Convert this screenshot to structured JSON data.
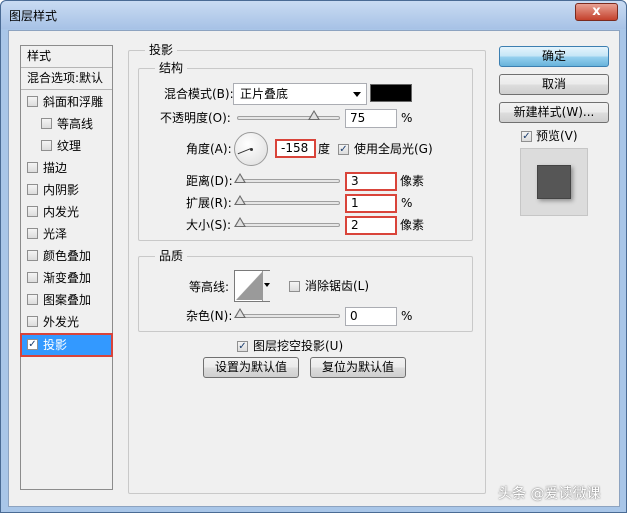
{
  "window": {
    "title": "图层样式",
    "close_glyph": "x"
  },
  "sidebar": {
    "header": "样式",
    "blend_options": "混合选项:默认",
    "items": [
      {
        "label": "斜面和浮雕",
        "checked": false,
        "indent": false
      },
      {
        "label": "等高线",
        "checked": false,
        "indent": true
      },
      {
        "label": "纹理",
        "checked": false,
        "indent": true
      },
      {
        "label": "描边",
        "checked": false,
        "indent": false
      },
      {
        "label": "内阴影",
        "checked": false,
        "indent": false
      },
      {
        "label": "内发光",
        "checked": false,
        "indent": false
      },
      {
        "label": "光泽",
        "checked": false,
        "indent": false
      },
      {
        "label": "颜色叠加",
        "checked": false,
        "indent": false
      },
      {
        "label": "渐变叠加",
        "checked": false,
        "indent": false
      },
      {
        "label": "图案叠加",
        "checked": false,
        "indent": false
      },
      {
        "label": "外发光",
        "checked": false,
        "indent": false
      },
      {
        "label": "投影",
        "checked": true,
        "indent": false,
        "selected": true
      }
    ],
    "check_glyph": "✓"
  },
  "drop_shadow": {
    "title": "投影",
    "structure": {
      "title": "结构",
      "blend_mode_label": "混合模式(B):",
      "blend_mode_value": "正片叠底",
      "blend_color": "#000000",
      "opacity_label": "不透明度(O):",
      "opacity_value": "75",
      "opacity_level": 0.75,
      "percent": "%",
      "angle_label": "角度(A):",
      "angle_value": "-158",
      "angle_unit": "度",
      "global_light_label": "使用全局光(G)",
      "global_light_checked": true,
      "distance_label": "距离(D):",
      "distance_value": "3",
      "distance_unit": "像素",
      "spread_label": "扩展(R):",
      "spread_value": "1",
      "size_label": "大小(S):",
      "size_value": "2",
      "size_unit": "像素"
    },
    "quality": {
      "title": "品质",
      "contour_label": "等高线:",
      "anti_alias_label": "消除锯齿(L)",
      "anti_alias_checked": false,
      "noise_label": "杂色(N):",
      "noise_value": "0",
      "percent": "%"
    },
    "knockout_label": "图层挖空投影(U)",
    "knockout_checked": true,
    "make_default": "设置为默认值",
    "reset_default": "复位为默认值"
  },
  "buttons": {
    "ok": "确定",
    "cancel": "取消",
    "new_style": "新建样式(W)...",
    "preview_label": "预览(V)",
    "preview_checked": true
  },
  "watermark": "头条 @爱读微课"
}
